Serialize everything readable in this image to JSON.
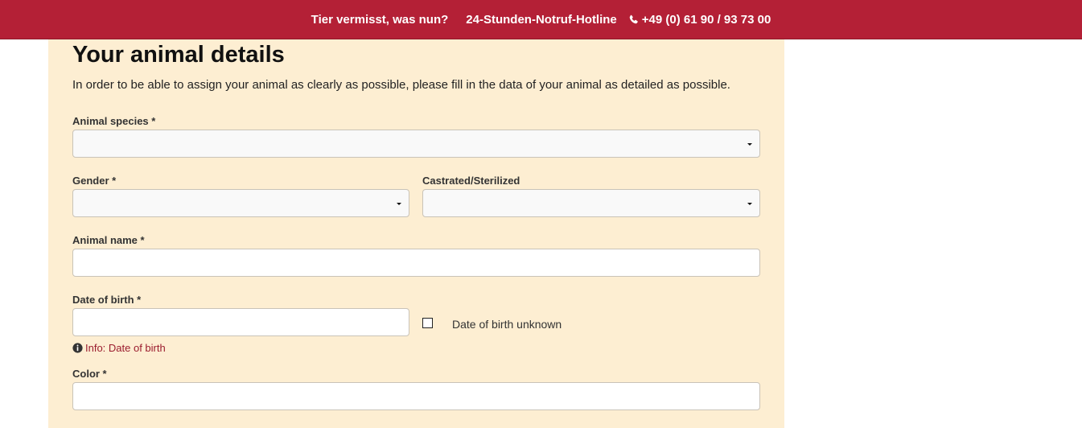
{
  "topbar": {
    "lost_animal_link": "Tier vermisst, was nun?",
    "hotline_label": "24-Stunden-Notruf-Hotline",
    "phone": "+49 (0) 61 90 / 93 73 00"
  },
  "form": {
    "title": "Your animal details",
    "intro": "In order to be able to assign your animal as clearly as possible, please fill in the data of your animal as detailed as possible.",
    "species": {
      "label": "Animal species *",
      "value": ""
    },
    "gender": {
      "label": "Gender *",
      "value": ""
    },
    "castrated": {
      "label": "Castrated/Sterilized",
      "value": ""
    },
    "name": {
      "label": "Animal name *",
      "value": ""
    },
    "dob": {
      "label": "Date of birth *",
      "value": "",
      "unknown_label": "Date of birth unknown",
      "unknown_checked": false,
      "info": "Info: Date of birth"
    },
    "color": {
      "label": "Color *",
      "value": ""
    }
  },
  "colors": {
    "brand": "#b42036",
    "panel": "#fdeed2",
    "info": "#9b1c2e"
  },
  "icons": {
    "phone": "phone-icon",
    "info": "info-circle-icon",
    "caret": "caret-down-icon"
  }
}
